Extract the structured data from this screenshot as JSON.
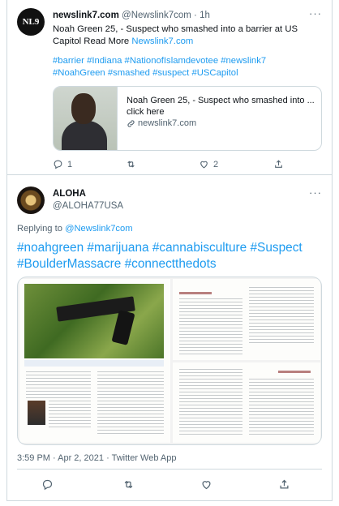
{
  "quoted_tweet": {
    "avatar_text": "NL9",
    "display_name": "newslink7.com",
    "handle": "@Newslink7com",
    "time": "1h",
    "text": "Noah Green 25, - Suspect who smashed into a barrier at US Capitol Read More ",
    "link": "Newslink7.com",
    "hashtags": "#barrier #Indiana #NationofIslamdevotee #newslink7 #NoahGreen #smashed #suspect #USCapitol",
    "card": {
      "title": "Noah Green 25, - Suspect who smashed into ...",
      "description": "click here",
      "domain": "newslink7.com"
    },
    "reply_count": "1",
    "retweet_count": "",
    "like_count": "2"
  },
  "main_tweet": {
    "display_name": "ALOHA",
    "handle": "@ALOHA77USA",
    "replying_prefix": "Replying to ",
    "replying_to": "@Newslink7com",
    "text": "#noahgreen #marijuana #cannabisculture #Suspect #BoulderMassacre #connectthedots",
    "timestamp": "3:59 PM · Apr 2, 2021 · Twitter Web App"
  },
  "icons": {
    "menu": "more-dots-icon",
    "link": "link-icon",
    "reply": "reply-icon",
    "retweet": "retweet-icon",
    "like": "heart-icon",
    "share": "share-icon"
  },
  "colors": {
    "link_blue": "#1d9bf0",
    "muted_gray": "#536471",
    "border": "#cfd9de"
  }
}
